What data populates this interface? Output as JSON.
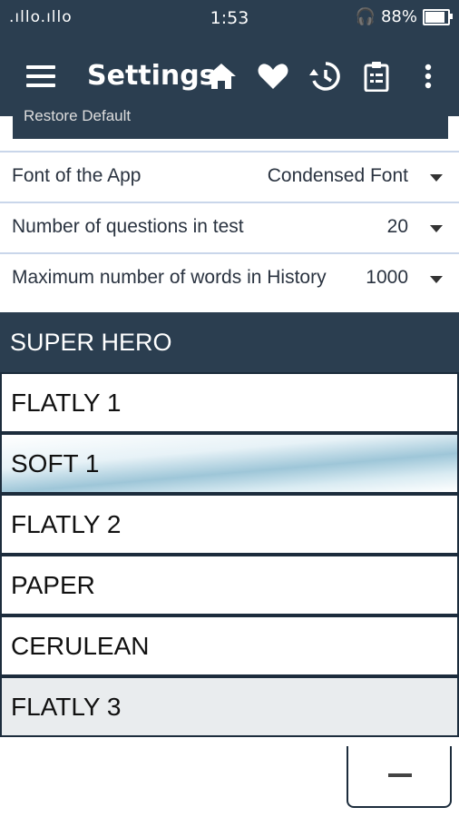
{
  "status_bar": {
    "signal": ".ıllo.ıllo",
    "time": "1:53",
    "battery_percent": "88%",
    "battery_level": 0.88
  },
  "toolbar": {
    "title": "Settings",
    "icons": [
      "menu-icon",
      "home-icon",
      "heart-icon",
      "history-icon",
      "clipboard-icon",
      "more-vert-icon"
    ]
  },
  "restore_button": {
    "label": "Restore Default"
  },
  "settings": [
    {
      "label": "Font of the App",
      "value": "Condensed Font"
    },
    {
      "label": "Number of questions in test",
      "value": "20"
    },
    {
      "label": "Maximum number of words in History",
      "value": "1000"
    }
  ],
  "themes_header": "SUPER HERO",
  "themes": [
    "FLATLY 1",
    "SOFT 1",
    "FLATLY 2",
    "PAPER",
    "CERULEAN",
    "FLATLY 3"
  ],
  "colors": {
    "primary": "#2b3e50",
    "divider": "#c9d6ea"
  }
}
